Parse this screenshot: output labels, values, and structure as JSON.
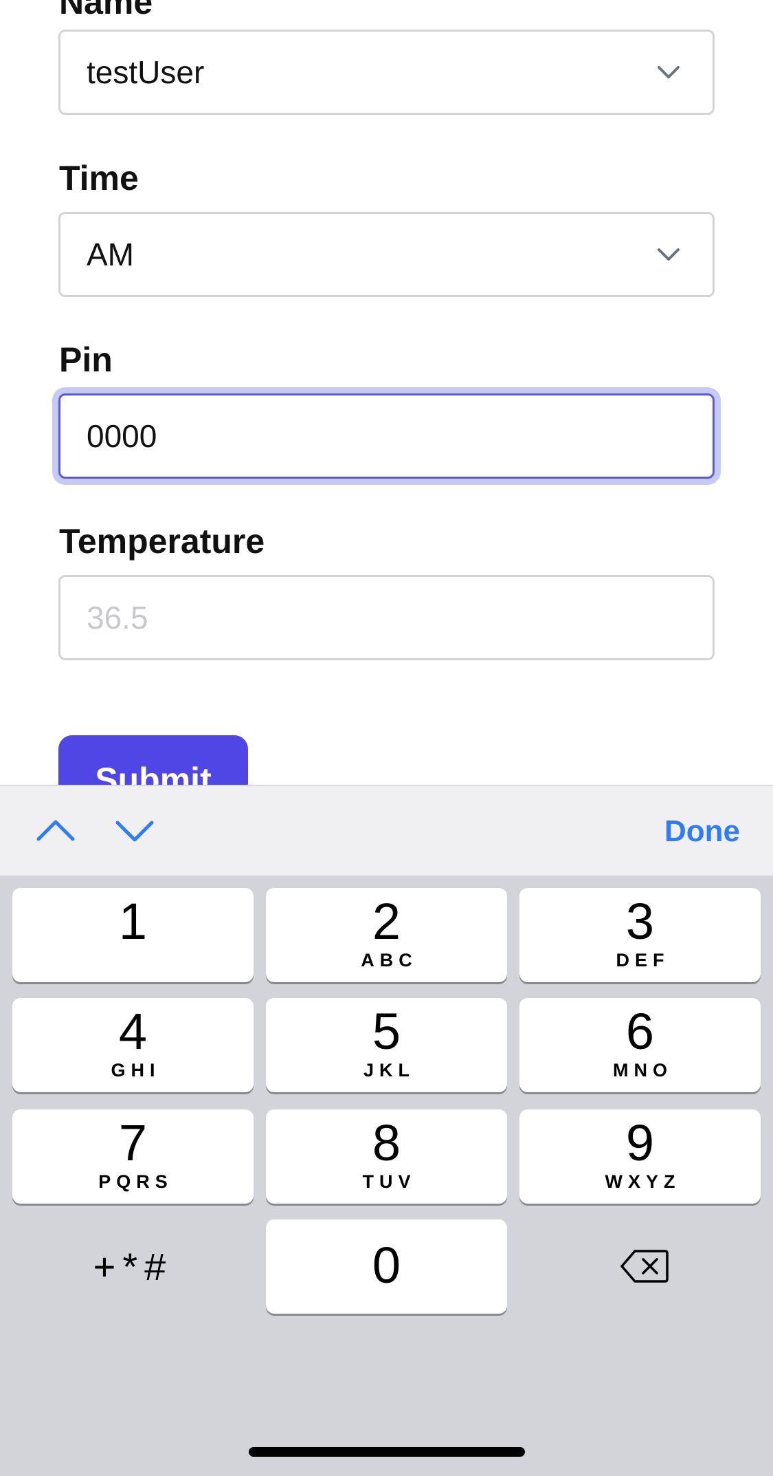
{
  "form": {
    "name": {
      "label": "Name",
      "value": "testUser"
    },
    "time": {
      "label": "Time",
      "value": "AM"
    },
    "pin": {
      "label": "Pin",
      "value": "0000"
    },
    "temperature": {
      "label": "Temperature",
      "placeholder": "36.5"
    },
    "submit_label": "Submit"
  },
  "accessory": {
    "done_label": "Done",
    "prev_icon": "chevron-up-icon",
    "next_icon": "chevron-down-icon"
  },
  "keypad": {
    "keys": [
      {
        "digit": "1",
        "letters": ""
      },
      {
        "digit": "2",
        "letters": "ABC"
      },
      {
        "digit": "3",
        "letters": "DEF"
      },
      {
        "digit": "4",
        "letters": "GHI"
      },
      {
        "digit": "5",
        "letters": "JKL"
      },
      {
        "digit": "6",
        "letters": "MNO"
      },
      {
        "digit": "7",
        "letters": "PQRS"
      },
      {
        "digit": "8",
        "letters": "TUV"
      },
      {
        "digit": "9",
        "letters": "WXYZ"
      },
      {
        "digit": "0",
        "letters": ""
      }
    ],
    "symbols_label": "+*#",
    "delete_icon": "backspace-icon"
  },
  "colors": {
    "accent": "#4f46e5",
    "link": "#2f7cf6",
    "focus_ring": "#c7c9f7",
    "keyboard_bg": "#d3d4d9"
  }
}
